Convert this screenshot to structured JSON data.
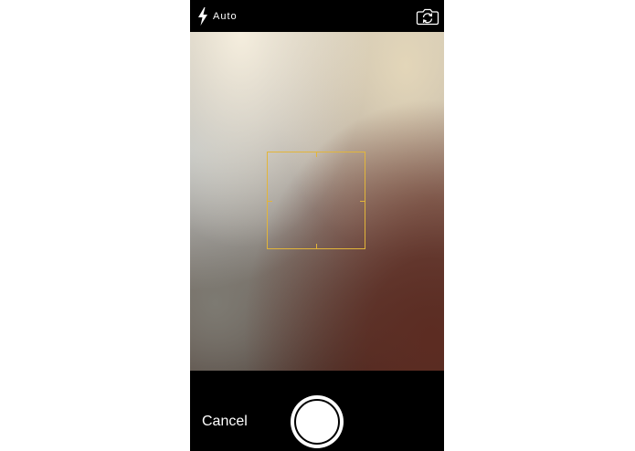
{
  "top_bar": {
    "flash": {
      "icon": "lightning-bolt-icon",
      "label": "Auto"
    },
    "switch_camera": {
      "icon": "camera-switch-icon"
    }
  },
  "viewfinder": {
    "focus_box": {
      "color": "#e2b53a"
    }
  },
  "bottom_bar": {
    "cancel_label": "Cancel",
    "shutter": {
      "icon": "shutter-icon"
    }
  }
}
